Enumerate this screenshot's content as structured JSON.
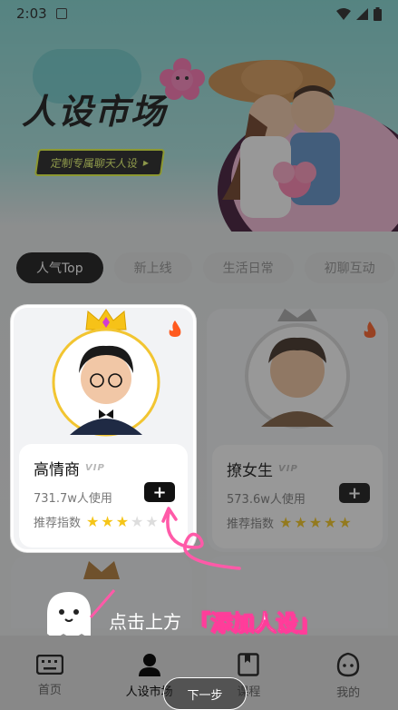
{
  "status_bar": {
    "time": "2:03"
  },
  "banner": {
    "title": "人设市场",
    "button_label": "定制专属聊天人设",
    "button_arrow": "▸"
  },
  "tabs": [
    {
      "label": "人气Top",
      "active": true
    },
    {
      "label": "新上线",
      "active": false
    },
    {
      "label": "生活日常",
      "active": false
    },
    {
      "label": "初聊互动",
      "active": false
    }
  ],
  "cards": [
    {
      "name": "高情商",
      "badge": "VIP",
      "users": "731.7w人使用",
      "rating_label": "推荐指数",
      "stars_on": 3,
      "stars_total": 5,
      "add_label": "+"
    },
    {
      "name": "撩女生",
      "badge": "VIP",
      "users": "573.6w人使用",
      "rating_label": "推荐指数",
      "stars_on": 5,
      "stars_total": 5,
      "add_label": "+"
    }
  ],
  "guide": {
    "prefix": "点击上方",
    "highlight": "「添加人设」",
    "next_button": "下一步"
  },
  "bottom_nav": [
    {
      "label": "首页",
      "icon": "keyboard-icon",
      "active": false
    },
    {
      "label": "人设市场",
      "icon": "person-icon",
      "active": true
    },
    {
      "label": "课程",
      "icon": "book-icon",
      "active": false
    },
    {
      "label": "我的",
      "icon": "face-icon",
      "active": false
    }
  ]
}
